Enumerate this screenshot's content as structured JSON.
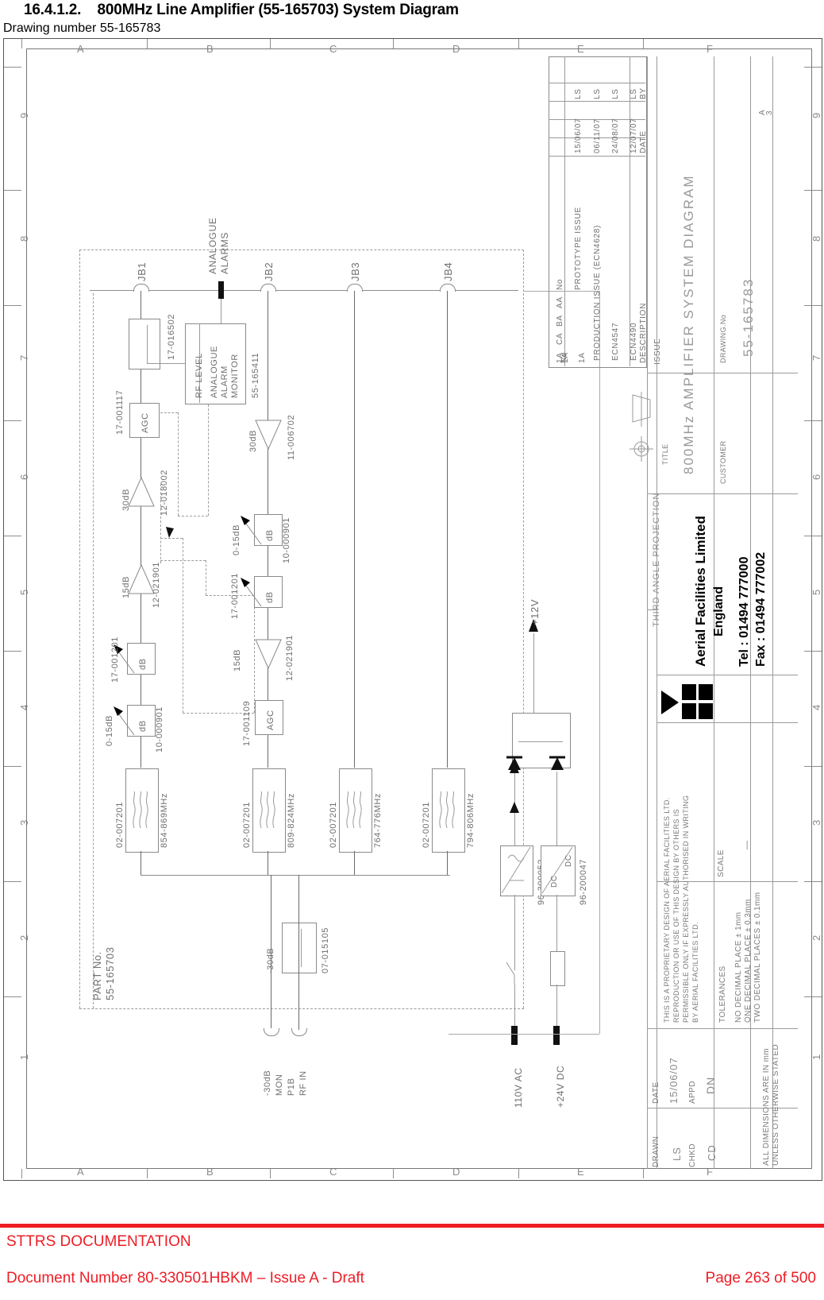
{
  "document": {
    "section_number": "16.4.1.2.",
    "heading": "800MHz Line Amplifier (55-165703) System Diagram",
    "subheading": "Drawing number 55-165783"
  },
  "footer": {
    "org": "STTRS DOCUMENTATION",
    "document_number": "Document Number 80-330501HBKM – Issue A - Draft",
    "page": "Page 263 of 500",
    "accent_color": "#ee1c25"
  },
  "frame": {
    "column_letters": [
      "A",
      "B",
      "C",
      "D",
      "E",
      "F"
    ],
    "row_numbers": [
      "9",
      "8",
      "7",
      "6",
      "5",
      "4",
      "3",
      "2",
      "1"
    ]
  },
  "diagram": {
    "part_no_label": "PART No.",
    "part_no_value": "55-165703",
    "connectors": [
      "JB1",
      "JB2",
      "JB3",
      "JB4"
    ],
    "analogue_alarms_label": "ANALOGUE\nALARMS",
    "analogue_alarms_line1": "ANALOGUE",
    "analogue_alarms_line2": "ALARMS",
    "alarm_monitor": {
      "rf_level": "RF LEVEL",
      "name_line1": "ANALOGUE",
      "name_line2": "ALARM",
      "name_line3": "MONITOR",
      "part": "55-165411"
    },
    "chain_a": {
      "coupler_part": "17-016502",
      "agc_label": "AGC",
      "agc_part": "17-001117",
      "amp1_gain": "30dB",
      "amp1_part": "12-018002",
      "amp2_gain": "15dB",
      "amp2_part": "12-021901",
      "att1_label": "dB",
      "att1_part": "17-001201",
      "att2_label": "dB",
      "att2_range": "0-15dB",
      "att2_part": "10-000901"
    },
    "chain_b": {
      "amp3_gain": "30dB",
      "amp3_part": "11-006702",
      "att3_label": "dB",
      "att3_range": "0-15dB",
      "att3_part": "10-000901",
      "att4_label": "dB",
      "att4_part": "17-001201",
      "amp4_gain": "15dB",
      "amp4_part": "12-021901",
      "agc2_label": "AGC",
      "agc2_part": "17-001109"
    },
    "filters": [
      {
        "part": "02-007201",
        "band": "854-869MHz"
      },
      {
        "part": "02-007201",
        "band": "809-824MHz"
      },
      {
        "part": "02-007201",
        "band": "764-776MHz"
      },
      {
        "part": "02-007201",
        "band": "794-806MHz"
      }
    ],
    "monitor_tap": {
      "level": "-30dB",
      "part": "07-015105"
    },
    "ports": [
      {
        "label": "-30dB"
      },
      {
        "label": "MON"
      },
      {
        "label": "P1B"
      },
      {
        "label": "RF IN"
      }
    ],
    "power": {
      "ac_input": "110V AC",
      "dc_input": "+24V DC",
      "psu_part": "96-300052",
      "dcdc_part": "96-200047",
      "dcdc_label_in": "DC",
      "dcdc_label_out": "DC",
      "output_rail": "+12V"
    }
  },
  "title_block": {
    "revision_headers": {
      "no": "No",
      "description": "DESCRIPTION",
      "date": "DATE",
      "by": "BY"
    },
    "revision_group_label": "ISSUE",
    "revisions": [
      {
        "no": "1A",
        "description": "PRODUCTION ISSUE (ECN4628)",
        "date": "06/11/07",
        "by": "LS"
      },
      {
        "no": "CA",
        "description": "ECN4547",
        "date": "24/08/07",
        "by": "LS"
      },
      {
        "no": "BA",
        "description": "ECN4490",
        "date": "12/07/07",
        "by": "LS"
      },
      {
        "no": "AA",
        "description": "PROTOTYPE ISSUE",
        "date": "15/06/07",
        "by": "LS"
      }
    ],
    "projection_label": "THIRD ANGLE PROJECTION",
    "company_name": "Aerial Facilities  Limited",
    "company_country": "England",
    "company_tel": "Tel : 01494 777000",
    "company_fax": "Fax : 01494 777002",
    "title_label": "TITLE",
    "title_value": "800MHz AMPLIFIER SYSTEM DIAGRAM",
    "drawing_no_label": "DRAWING.No",
    "drawing_no_value": "55-165783",
    "customer_label": "CUSTOMER",
    "customer_value": "",
    "sheet_size": "A",
    "sheet_size_sub": "3",
    "proprietary_notice_lines": [
      "THIS IS A PROPRIETARY DESIGN OF AERIAL FACILITIES LTD.",
      "REPRODUCTION OR USE OF THIS DESIGN BY OTHERS IS",
      "PERMISSIBLE ONLY IF EXPRESSLY AUTHORISED IN WRITING",
      "BY AERIAL FACILITIES LTD."
    ],
    "tolerances_label": "TOLERANCES",
    "tolerance_lines": [
      "NO DECIMAL PLACE ± 1mm",
      "ONE DECIMAL PLACE ± 0.3mm",
      "TWO DECIMAL PLACES ± 0.1mm"
    ],
    "units_note_line1": "ALL DIMENSIONS ARE IN mm",
    "units_note_line2": "UNLESS OTHERWISE STATED",
    "scale_label": "SCALE",
    "scale_value": "—",
    "date_label": "DATE",
    "date_value": "15/06/07",
    "appd_label": "APPD",
    "appd_value": "DN",
    "drawn_label": "DRAWN",
    "drawn_value": "LS",
    "chkd_label": "CHKD",
    "chkd_value": "CD"
  }
}
